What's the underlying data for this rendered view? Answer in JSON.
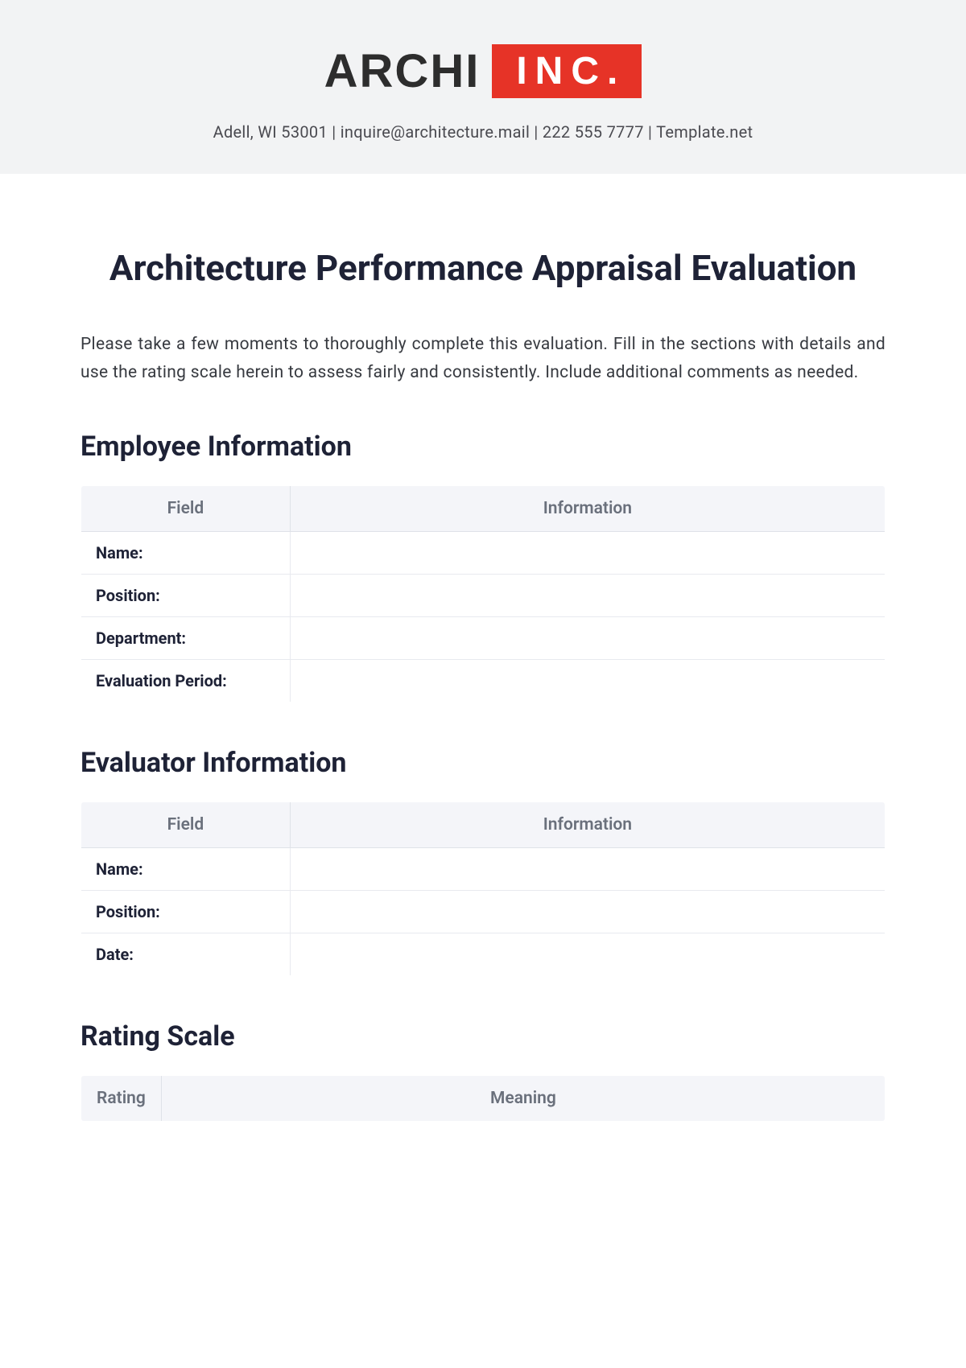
{
  "header": {
    "logo_left": "ARCHI",
    "logo_right": "INC.",
    "contact_line": "Adell, WI 53001 | inquire@architecture.mail | 222 555 7777 | Template.net"
  },
  "title": "Architecture Performance Appraisal Evaluation",
  "intro": "Please take a few moments to thoroughly complete this evaluation. Fill in the sections with details and use the rating scale herein to assess fairly and consistently. Include additional comments as needed.",
  "employee_section": {
    "heading": "Employee Information",
    "col1": "Field",
    "col2": "Information",
    "rows": [
      {
        "label": "Name:",
        "value": ""
      },
      {
        "label": "Position:",
        "value": ""
      },
      {
        "label": "Department:",
        "value": ""
      },
      {
        "label": "Evaluation Period:",
        "value": ""
      }
    ]
  },
  "evaluator_section": {
    "heading": "Evaluator Information",
    "col1": "Field",
    "col2": "Information",
    "rows": [
      {
        "label": "Name:",
        "value": ""
      },
      {
        "label": "Position:",
        "value": ""
      },
      {
        "label": "Date:",
        "value": ""
      }
    ]
  },
  "rating_section": {
    "heading": "Rating Scale",
    "col1": "Rating",
    "col2": "Meaning"
  }
}
